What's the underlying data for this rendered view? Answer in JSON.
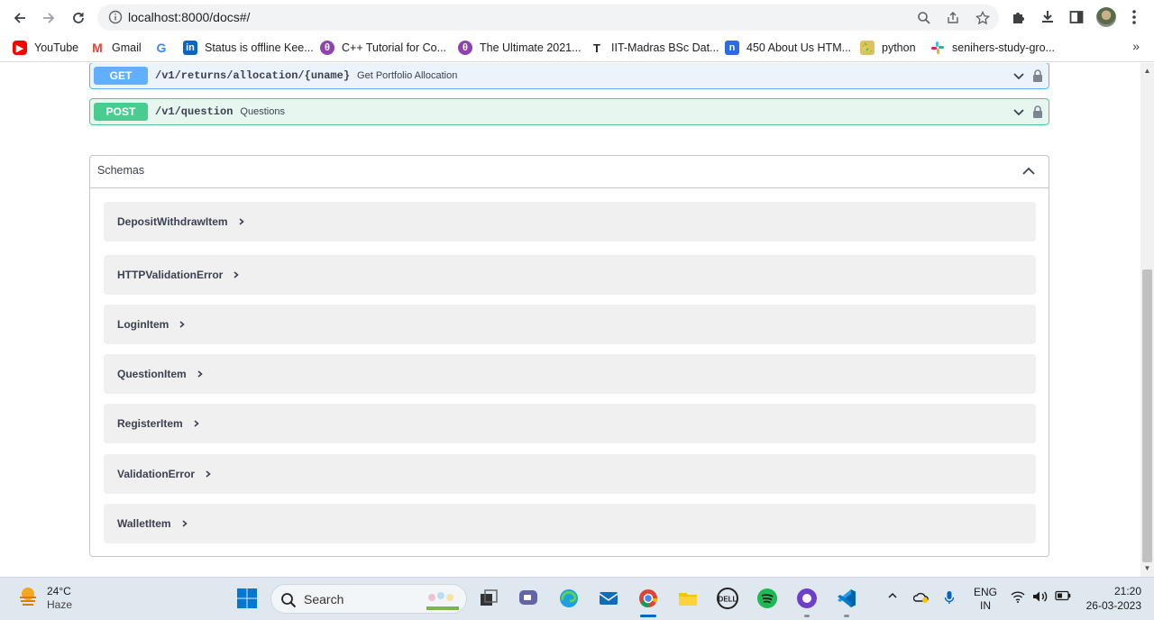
{
  "browser": {
    "url": "localhost:8000/docs#/",
    "bookmarks": [
      {
        "label": "YouTube",
        "icon": "youtube-icon",
        "color": "#ff0000"
      },
      {
        "label": "Gmail",
        "icon": "gmail-icon",
        "color": "#ea4335"
      },
      {
        "label": "",
        "icon": "google-icon",
        "color": "#4285f4"
      },
      {
        "label": "Status is offline Kee...",
        "icon": "linkedin-icon",
        "color": "#0a66c2"
      },
      {
        "label": "C++ Tutorial for Co...",
        "icon": "course-icon",
        "color": "#8e44ad"
      },
      {
        "label": "The Ultimate 2021...",
        "icon": "course-icon",
        "color": "#8e44ad"
      },
      {
        "label": "IIT-Madras BSc Dat...",
        "icon": "t-icon",
        "color": "#222222"
      },
      {
        "label": "450 About Us HTM...",
        "icon": "n-icon",
        "color": "#2d6cdf"
      },
      {
        "label": "python",
        "icon": "folder-python-icon",
        "color": "#c9a227"
      },
      {
        "label": "senihers-study-gro...",
        "icon": "slack-icon",
        "color": "#4a154b"
      }
    ],
    "more": "»"
  },
  "api": {
    "operations": [
      {
        "method": "GET",
        "path": "/v1/returns/allocation/{uname}",
        "summary": "Get Portfolio Allocation"
      },
      {
        "method": "POST",
        "path": "/v1/question",
        "summary": "Questions"
      }
    ],
    "schemas_title": "Schemas",
    "schemas": [
      "DepositWithdrawItem",
      "HTTPValidationError",
      "LoginItem",
      "QuestionItem",
      "RegisterItem",
      "ValidationError",
      "WalletItem"
    ]
  },
  "taskbar": {
    "temperature": "24°C",
    "condition": "Haze",
    "search_label": "Search",
    "lang_top": "ENG",
    "lang_bottom": "IN",
    "time": "21:20",
    "date": "26-03-2023"
  },
  "colors": {
    "get": "#61affe",
    "post": "#49cc90",
    "taskbar_bg": "#dfe7ef"
  }
}
